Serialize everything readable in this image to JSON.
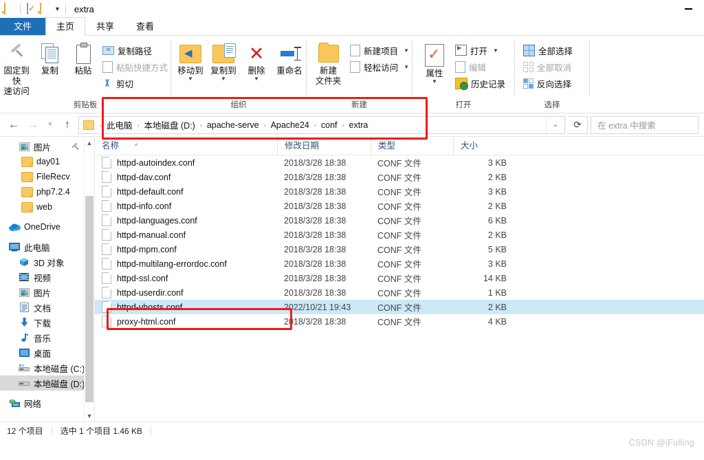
{
  "window": {
    "title": "extra",
    "quick_access": [
      "folder-icon",
      "properties-icon",
      "new-folder-icon",
      "dropdown-caret"
    ],
    "minimize_label": "—"
  },
  "tabs": [
    {
      "label": "文件",
      "kind": "file"
    },
    {
      "label": "主页",
      "kind": "active"
    },
    {
      "label": "共享",
      "kind": "normal"
    },
    {
      "label": "查看",
      "kind": "normal"
    }
  ],
  "ribbon": {
    "groups": [
      {
        "label": "剪贴板",
        "big": [
          {
            "label_line1": "固定到快",
            "label_line2": "速访问",
            "icon": "pin-icon"
          },
          {
            "label_line1": "复制",
            "label_line2": "",
            "icon": "copy-icon"
          },
          {
            "label_line1": "粘贴",
            "label_line2": "",
            "icon": "paste-icon"
          }
        ],
        "small": [
          {
            "label": "复制路径",
            "icon": "copy-path-icon",
            "disabled": false
          },
          {
            "label": "粘贴快捷方式",
            "icon": "paste-shortcut-icon",
            "disabled": true
          },
          {
            "label": "剪切",
            "icon": "cut-icon",
            "disabled": false
          }
        ]
      },
      {
        "label": "组织",
        "big": [
          {
            "label_line1": "移动到",
            "label_line2": "",
            "icon": "move-to-icon",
            "caret": true
          },
          {
            "label_line1": "复制到",
            "label_line2": "",
            "icon": "copy-to-icon",
            "caret": true
          },
          {
            "label_line1": "删除",
            "label_line2": "",
            "icon": "delete-icon",
            "caret": true
          },
          {
            "label_line1": "重命名",
            "label_line2": "",
            "icon": "rename-icon"
          }
        ]
      },
      {
        "label": "新建",
        "big": [
          {
            "label_line1": "新建",
            "label_line2": "文件夹",
            "icon": "new-folder-icon"
          }
        ],
        "small": [
          {
            "label": "新建项目",
            "icon": "new-item-icon",
            "caret": true
          },
          {
            "label": "轻松访问",
            "icon": "easy-access-icon",
            "caret": true
          }
        ]
      },
      {
        "label": "打开",
        "big": [
          {
            "label_line1": "属性",
            "label_line2": "",
            "icon": "properties-icon",
            "caret": true
          }
        ],
        "small": [
          {
            "label": "打开",
            "icon": "open-icon",
            "caret": true,
            "disabled": false
          },
          {
            "label": "编辑",
            "icon": "edit-icon",
            "disabled": true
          },
          {
            "label": "历史记录",
            "icon": "history-icon",
            "disabled": false
          }
        ]
      },
      {
        "label": "选择",
        "small": [
          {
            "label": "全部选择",
            "icon": "select-all-icon"
          },
          {
            "label": "全部取消",
            "icon": "select-none-icon"
          },
          {
            "label": "反向选择",
            "icon": "invert-selection-icon"
          }
        ]
      }
    ]
  },
  "addressbar": {
    "back_icon": "back-arrow-icon",
    "forward_icon": "forward-arrow-icon",
    "recent_icon": "recent-locations-caret",
    "up_icon": "up-arrow-icon",
    "breadcrumbs": [
      "此电脑",
      "本地磁盘 (D:)",
      "apache-serve",
      "Apache24",
      "conf",
      "extra"
    ],
    "separator": "›",
    "dropdown_icon": "chevron-down-icon",
    "refresh_icon": "refresh-icon",
    "search_placeholder": "在 extra 中搜索"
  },
  "navpane": {
    "items": [
      {
        "label": "图片",
        "icon": "pictures-icon",
        "indent": 1,
        "pinned": true
      },
      {
        "label": "day01",
        "icon": "folder-icon",
        "indent": 2
      },
      {
        "label": "FileRecv",
        "icon": "folder-icon",
        "indent": 2
      },
      {
        "label": "php7.2.4",
        "icon": "folder-icon",
        "indent": 2
      },
      {
        "label": "web",
        "icon": "folder-icon",
        "indent": 2
      },
      {
        "label": "OneDrive",
        "icon": "onedrive-icon",
        "indent": 1,
        "gap_before": true
      },
      {
        "label": "此电脑",
        "icon": "this-pc-icon",
        "indent": 1,
        "gap_before": true
      },
      {
        "label": "3D 对象",
        "icon": "3d-objects-icon",
        "indent": 2
      },
      {
        "label": "视频",
        "icon": "videos-icon",
        "indent": 2
      },
      {
        "label": "图片",
        "icon": "pictures-icon",
        "indent": 2
      },
      {
        "label": "文档",
        "icon": "documents-icon",
        "indent": 2
      },
      {
        "label": "下载",
        "icon": "downloads-icon",
        "indent": 2
      },
      {
        "label": "音乐",
        "icon": "music-icon",
        "indent": 2
      },
      {
        "label": "桌面",
        "icon": "desktop-icon",
        "indent": 2
      },
      {
        "label": "本地磁盘 (C:)",
        "icon": "drive-icon",
        "indent": 2
      },
      {
        "label": "本地磁盘 (D:)",
        "icon": "drive-icon",
        "indent": 2,
        "selected": true
      },
      {
        "label": "网络",
        "icon": "network-icon",
        "indent": 1,
        "gap_before": true
      }
    ]
  },
  "filelist": {
    "columns": [
      {
        "label": "名称",
        "sorted": true,
        "sort_glyph": "^"
      },
      {
        "label": "修改日期"
      },
      {
        "label": "类型"
      },
      {
        "label": "大小"
      }
    ],
    "rows": [
      {
        "name": "httpd-autoindex.conf",
        "date": "2018/3/28 18:38",
        "type": "CONF 文件",
        "size": "3 KB"
      },
      {
        "name": "httpd-dav.conf",
        "date": "2018/3/28 18:38",
        "type": "CONF 文件",
        "size": "2 KB"
      },
      {
        "name": "httpd-default.conf",
        "date": "2018/3/28 18:38",
        "type": "CONF 文件",
        "size": "3 KB"
      },
      {
        "name": "httpd-info.conf",
        "date": "2018/3/28 18:38",
        "type": "CONF 文件",
        "size": "2 KB"
      },
      {
        "name": "httpd-languages.conf",
        "date": "2018/3/28 18:38",
        "type": "CONF 文件",
        "size": "6 KB"
      },
      {
        "name": "httpd-manual.conf",
        "date": "2018/3/28 18:38",
        "type": "CONF 文件",
        "size": "2 KB"
      },
      {
        "name": "httpd-mpm.conf",
        "date": "2018/3/28 18:38",
        "type": "CONF 文件",
        "size": "5 KB"
      },
      {
        "name": "httpd-multilang-errordoc.conf",
        "date": "2018/3/28 18:38",
        "type": "CONF 文件",
        "size": "3 KB"
      },
      {
        "name": "httpd-ssl.conf",
        "date": "2018/3/28 18:38",
        "type": "CONF 文件",
        "size": "14 KB"
      },
      {
        "name": "httpd-userdir.conf",
        "date": "2018/3/28 18:38",
        "type": "CONF 文件",
        "size": "1 KB"
      },
      {
        "name": "httpd-vhosts.conf",
        "date": "2022/10/21 19:43",
        "type": "CONF 文件",
        "size": "2 KB",
        "selected": true
      },
      {
        "name": "proxy-html.conf",
        "date": "2018/3/28 18:38",
        "type": "CONF 文件",
        "size": "4 KB"
      }
    ]
  },
  "statusbar": {
    "count": "12 个项目",
    "selection": "选中 1 个项目  1.46 KB"
  },
  "watermark": "CSDN @iFulling",
  "colors": {
    "accent": "#1e6fb8",
    "selection": "#cde8f7",
    "annotation": "#ef1b1b",
    "folder": "#fbc65b"
  }
}
